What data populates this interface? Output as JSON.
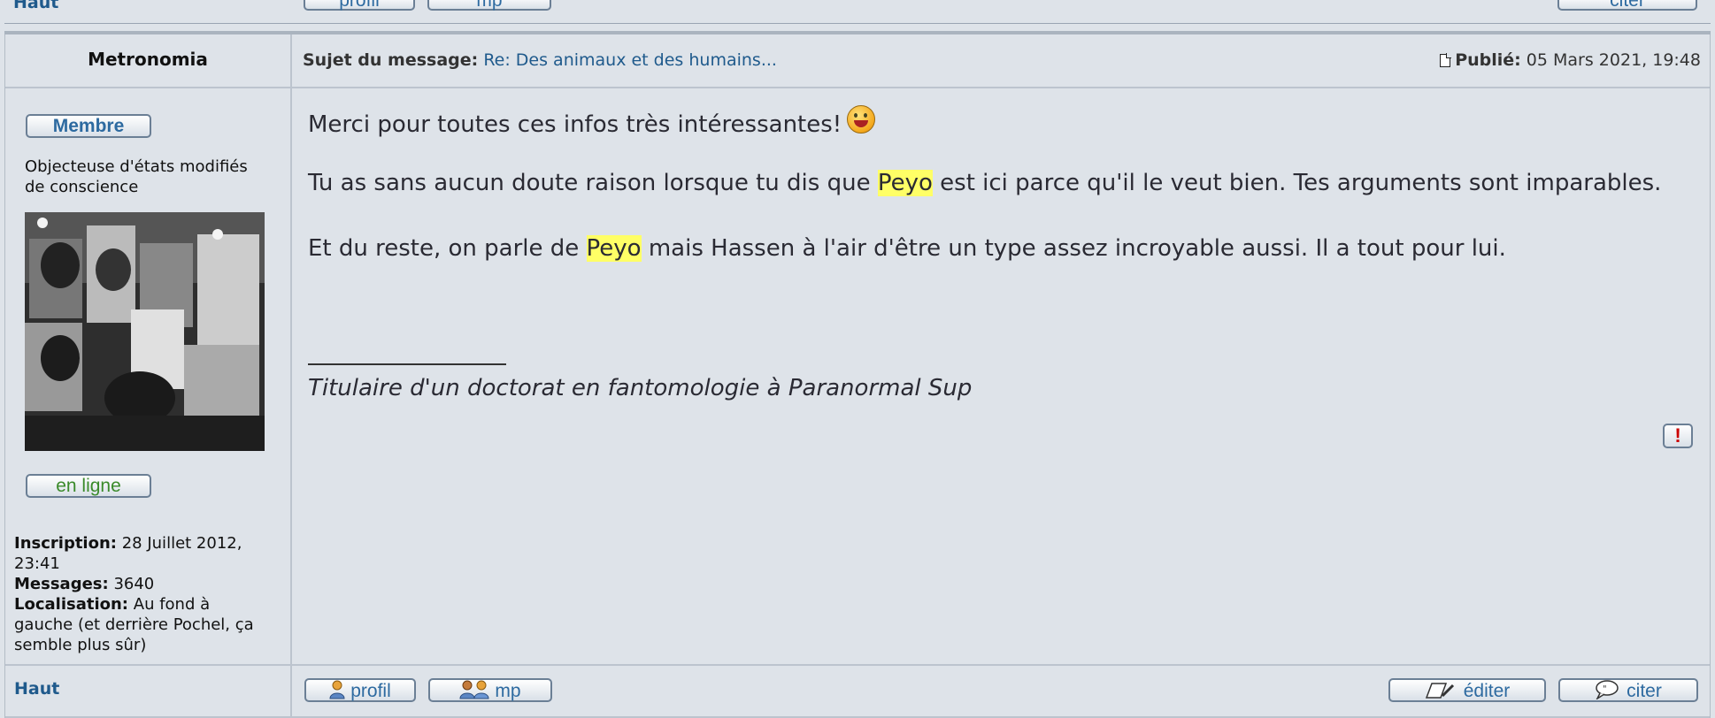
{
  "prev_row": {
    "top_label": "Haut",
    "buttons": [
      {
        "label": "profil"
      },
      {
        "label": "mp"
      },
      {
        "label": "citer"
      }
    ]
  },
  "post": {
    "author": "Metronomia",
    "subject_label": "Sujet du message:",
    "subject_link": "Re: Des animaux et des humains...",
    "published_label": "Publié:",
    "published_date": "05 Mars 2021, 19:48",
    "rank_label": "Membre",
    "user_title_line1": "Objecteuse d'états modifiés",
    "user_title_line2": "de conscience",
    "status_label": "en ligne",
    "profile": {
      "inscription_label": "Inscription:",
      "inscription_value": "28 Juillet 2012,",
      "inscription_value2": "23:41",
      "messages_label": "Messages:",
      "messages_value": "3640",
      "location_label": "Localisation:",
      "location_value1": "Au fond à",
      "location_value2": "gauche (et derrière Pochel, ça",
      "location_value3": "semble plus sûr)"
    },
    "body": {
      "p1": "Merci pour toutes ces infos très intéressantes!",
      "p2_a": "Tu as sans aucun doute raison lorsque tu dis que ",
      "p2_hl": "Peyo",
      "p2_b": " est ici parce qu'il le veut bien. Tes arguments sont imparables.",
      "p3_a": "Et du reste, on parle de ",
      "p3_hl": "Peyo",
      "p3_b": " mais Hassen à l'air d'être un type assez incroyable aussi. Il a tout pour lui.",
      "signature": "Titulaire d'un doctorat en fantomologie à Paranormal Sup"
    },
    "report_glyph": "!",
    "footer": {
      "top_label": "Haut",
      "profil_label": "profil",
      "mp_label": "mp",
      "edit_label": "éditer",
      "quote_label": "citer"
    }
  },
  "icons": {
    "smiley": "smiley-tongue-icon",
    "doc": "document-icon",
    "report": "report-icon",
    "user": "user-icon",
    "users": "users-icon",
    "edit": "edit-icon",
    "quote": "quote-icon"
  },
  "colors": {
    "background": "#dee3e9",
    "link": "#1f5a8c",
    "highlight": "#ffff66",
    "online": "#3a8a2a"
  }
}
